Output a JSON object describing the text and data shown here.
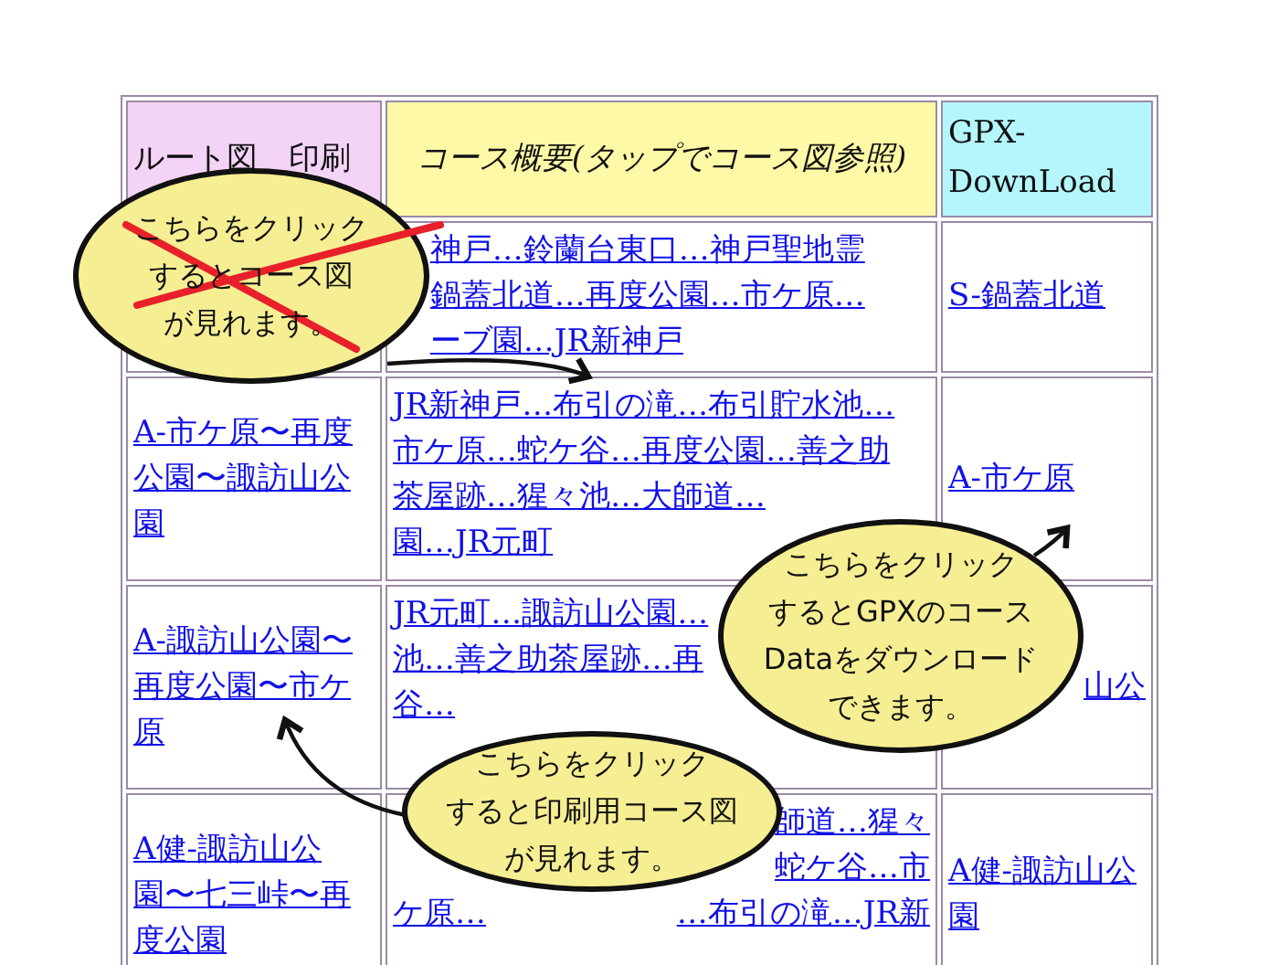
{
  "table": {
    "columns": [
      {
        "label": "ルート図　印刷",
        "kind": "plain",
        "color": "#f4d4f6"
      },
      {
        "label": "コース概要(タップでコース図参照)",
        "kind": "italic",
        "color": "#fdf9a6"
      },
      {
        "label": "GPX-DownLoad",
        "kind": "plain",
        "color": "#b4f6fc"
      }
    ],
    "rows": [
      {
        "course": [
          {
            "kind": "tail",
            "text": "神戸…鈴蘭台東口…神戸聖地霊"
          },
          {
            "kind": "tail",
            "text": "鍋蓋北道…再度公園…市ケ原…"
          },
          {
            "kind": "tail",
            "text": "ーブ園…JR新神戸"
          }
        ],
        "gpx": {
          "kind": "full",
          "text": "S-鍋蓋北道"
        }
      },
      {
        "route": "A-市ケ原〜再度公園〜諏訪山公園",
        "course": [
          {
            "kind": "full",
            "text": "JR新神戸…布引の滝…布引貯水池…"
          },
          {
            "kind": "full",
            "text": "市ケ原…蛇ケ谷…再度公園…善之助"
          },
          {
            "kind": "full",
            "text": "茶屋跡…猩々池…大師道…"
          },
          {
            "kind": "full",
            "text": "園…JR元町"
          }
        ],
        "gpx": {
          "kind": "full",
          "text": "A-市ケ原"
        }
      },
      {
        "route": "A-諏訪山公園〜再度公園〜市ケ原",
        "course": [
          {
            "kind": "full",
            "text": "JR元町…諏訪山公園…"
          },
          {
            "kind": "full",
            "text": "池…善之助茶屋跡…再"
          },
          {
            "kind": "full",
            "text": "谷…"
          }
        ],
        "gpx": {
          "kind": "end",
          "text": "山公"
        }
      },
      {
        "route": "A健-諏訪山公園〜七三峠〜再度公園",
        "course": [
          {
            "kind": "end",
            "text": "師道…猩々"
          },
          {
            "kind": "end",
            "text": "蛇ケ谷…市"
          },
          {
            "kind": "split",
            "text": "ケ原…",
            "tail": "…布引の滝…JR新"
          }
        ],
        "gpx": {
          "kind": "full",
          "text": "A健-諏訪山公園"
        }
      }
    ]
  },
  "callouts": [
    {
      "lines": [
        "こちらをクリック",
        "するとコース図",
        "が見れます。"
      ],
      "crossed_out": true
    },
    {
      "lines": [
        "こちらをクリック",
        "するとGPXのコース",
        "Dataをダウンロード",
        "できます。"
      ],
      "crossed_out": false
    },
    {
      "lines": [
        "こちらをクリック",
        "すると印刷用コース図",
        "が見れます。"
      ],
      "crossed_out": false
    }
  ]
}
